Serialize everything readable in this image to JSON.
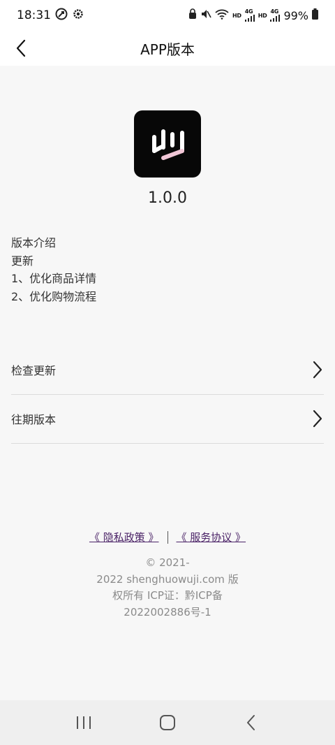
{
  "status_bar": {
    "time": "18:31",
    "network_label_1": "HD",
    "network_tag_1": "4G",
    "network_label_2": "HD",
    "network_tag_2": "4G",
    "battery": "99%"
  },
  "header": {
    "title": "APP版本"
  },
  "app": {
    "version": "1.0.0"
  },
  "intro": {
    "heading": "版本介绍",
    "lines": [
      "更新",
      "1、优化商品详情",
      "2、优化购物流程"
    ]
  },
  "menu": {
    "check_update": "检查更新",
    "past_versions": "往期版本"
  },
  "footer": {
    "privacy_link": "《 隐私政策 》",
    "service_link": "《 服务协议 》",
    "copyright_lines": [
      "© 2021-",
      "2022 shenghuowuji.com 版",
      "权所有 ICP证：黔ICP备",
      "2022002886号-1"
    ]
  },
  "colors": {
    "link": "#4b2367",
    "logo_bg": "#070707"
  }
}
